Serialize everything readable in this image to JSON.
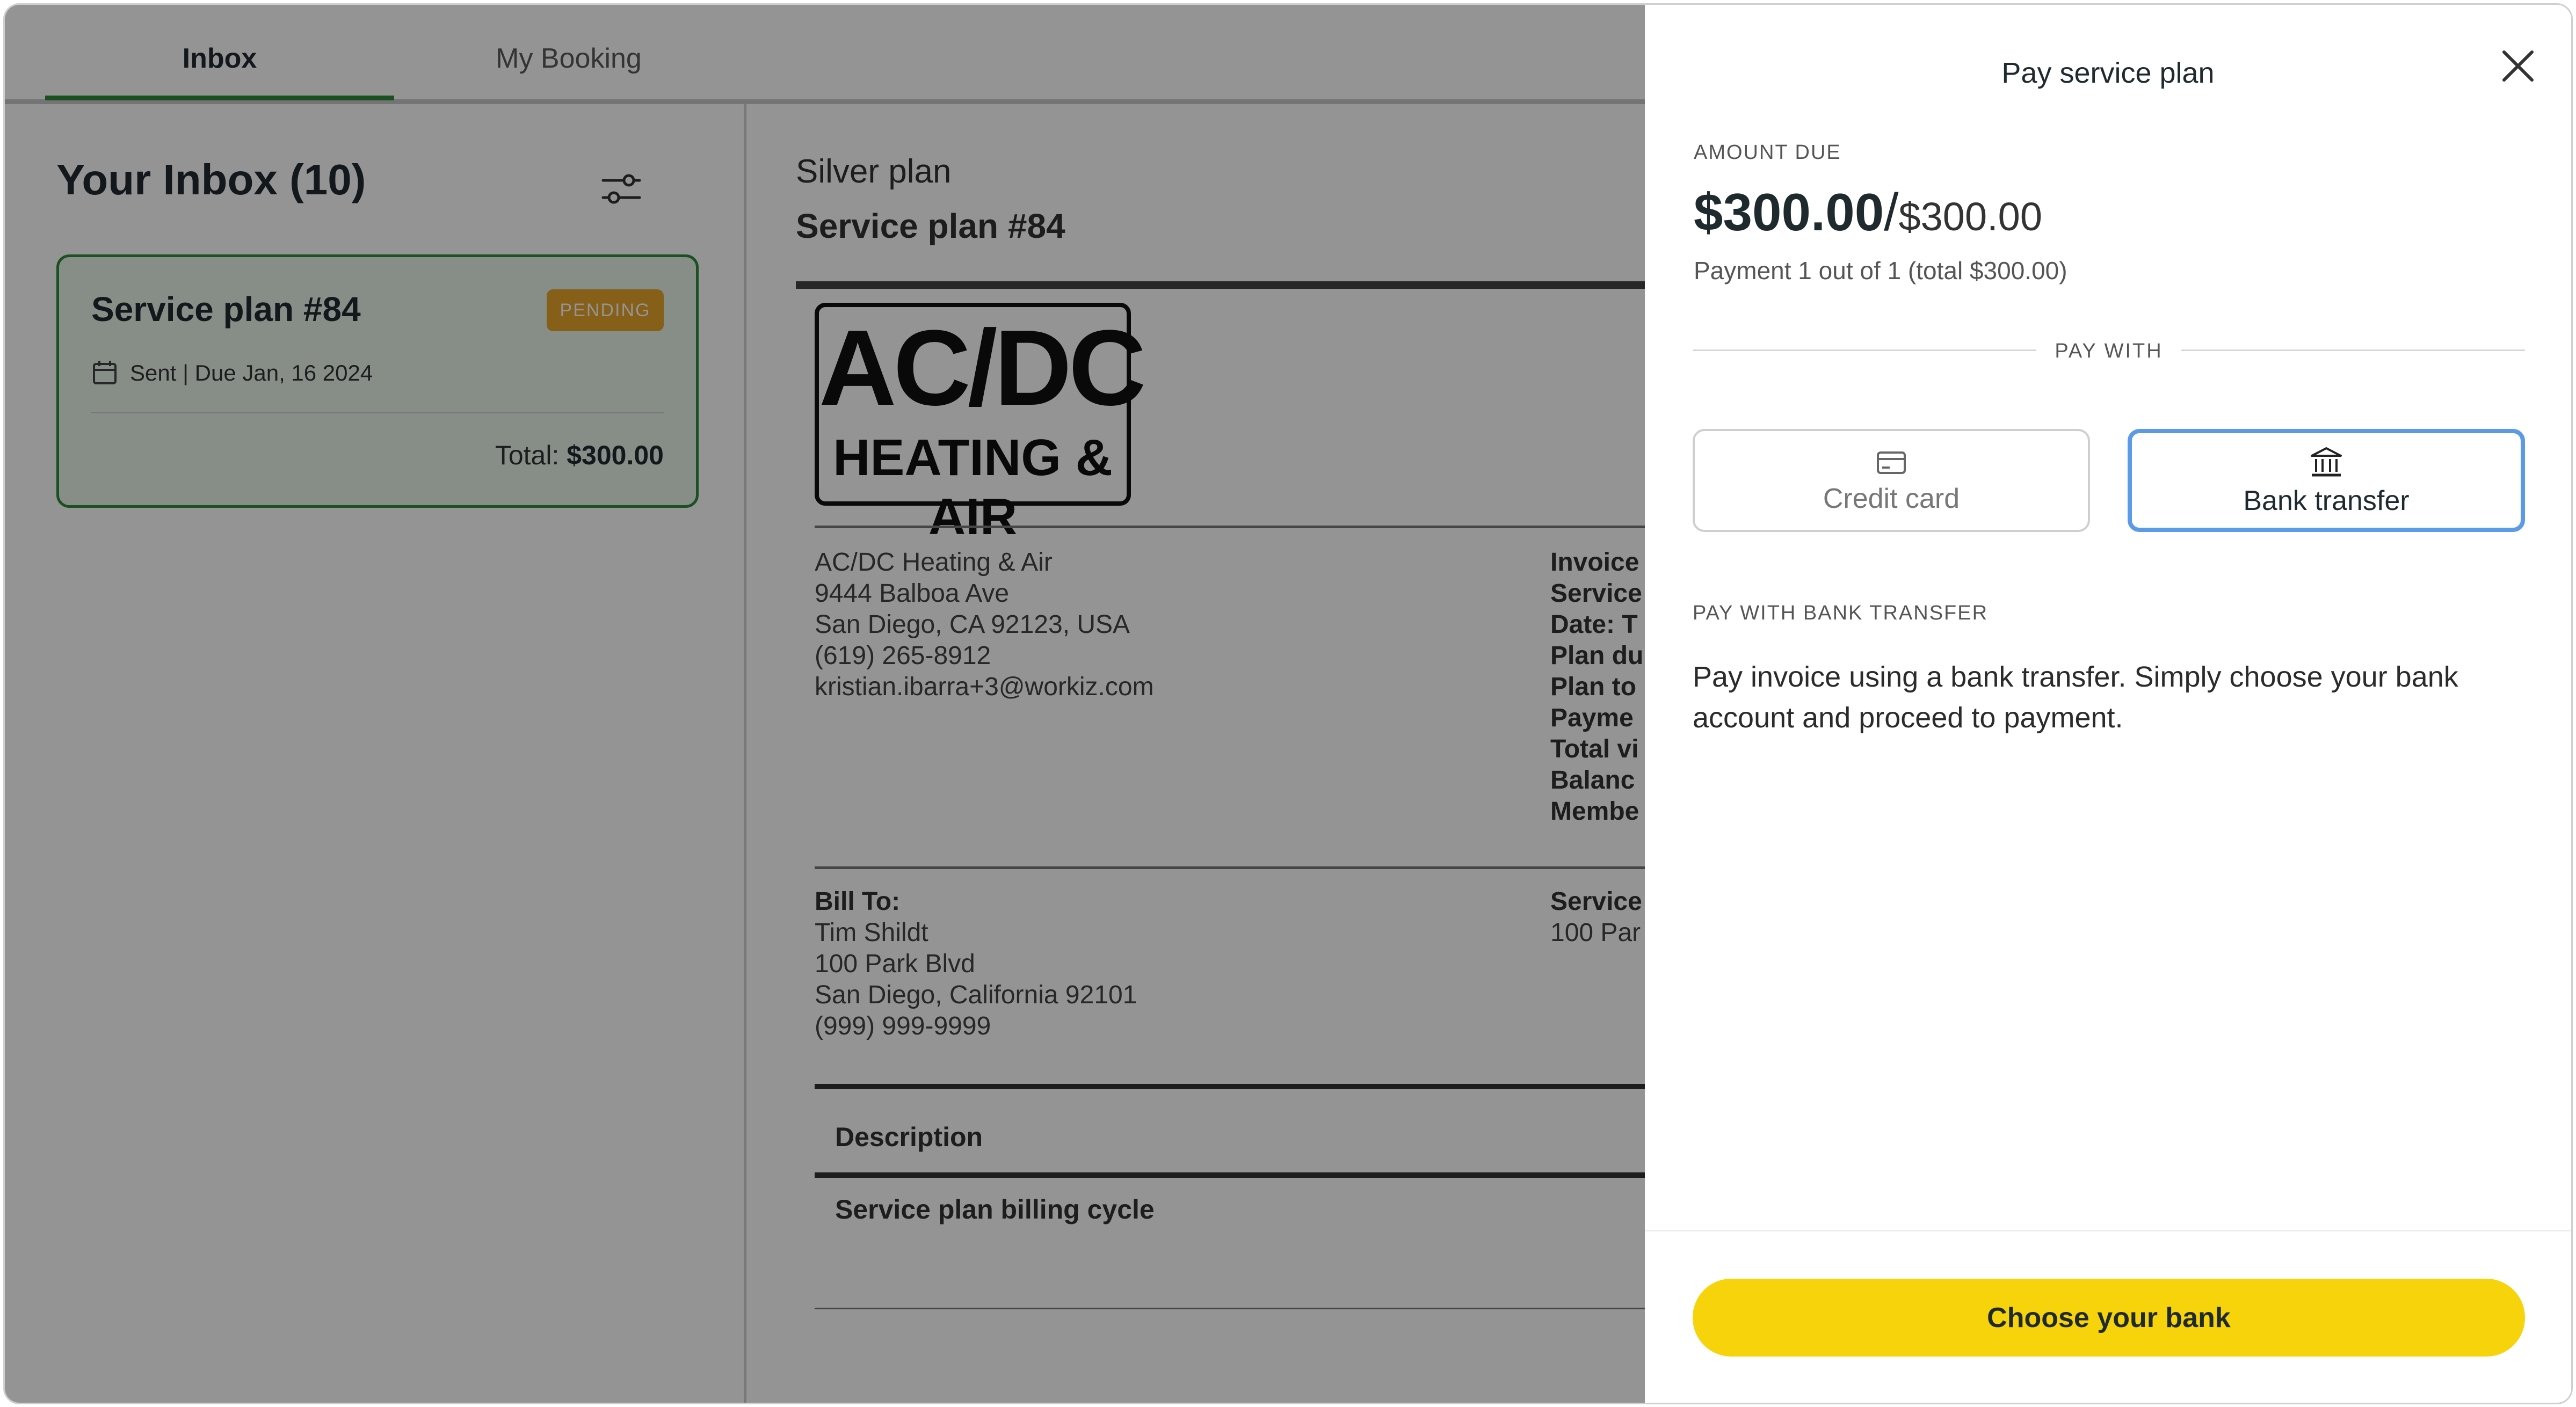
{
  "tabs": {
    "inbox": "Inbox",
    "my_booking": "My Booking"
  },
  "inbox": {
    "title": "Your Inbox (10)",
    "card": {
      "title": "Service plan #84",
      "badge": "PENDING",
      "date": "Sent | Due Jan, 16 2024",
      "total_label": "Total:",
      "total_value": "$300.00"
    }
  },
  "invoice": {
    "plan_name": "Silver plan",
    "plan_title": "Service plan #84",
    "logo_line1": "AC/DC",
    "logo_line2": "HEATING & AIR",
    "company": {
      "name": "AC/DC Heating & Air",
      "address1": "9444 Balboa Ave",
      "address2": "San Diego, CA 92123, USA",
      "phone": "(619) 265-8912",
      "email": "kristian.ibarra+3@workiz.com"
    },
    "meta": [
      "Invoice",
      "Service",
      "Date: T",
      "Plan du",
      "Plan to",
      "Payme",
      "Total vi",
      "Balanc",
      "Membe"
    ],
    "bill_to": {
      "label": "Bill To:",
      "name": "Tim Shildt",
      "address1": "100 Park Blvd",
      "address2": "San Diego, California 92101",
      "phone": "(999) 999-9999"
    },
    "service": {
      "label": "Service",
      "address": "100 Par"
    },
    "description_header": "Description",
    "description_row": "Service plan billing cycle"
  },
  "drawer": {
    "title": "Pay service plan",
    "amount_label": "AMOUNT DUE",
    "amount_due": "$300.00",
    "amount_slash": "/",
    "amount_total": "$300.00",
    "payment_info": "Payment 1 out of 1 (total $300.00)",
    "pay_with_label": "PAY WITH",
    "methods": {
      "credit_card": "Credit card",
      "bank_transfer": "Bank transfer"
    },
    "selected_method": "bank_transfer",
    "bank_section_label": "PAY WITH BANK TRANSFER",
    "bank_description": "Pay invoice using a bank transfer. Simply choose your bank account and proceed to payment.",
    "choose_bank_button": "Choose your bank"
  },
  "colors": {
    "accent_green": "#2e8b3c",
    "pending_badge": "#e7a42a",
    "selected_border": "#5b9be6",
    "primary_button": "#f6d30a"
  },
  "icons": {
    "filter": "filter-sliders-icon",
    "calendar": "calendar-icon",
    "credit_card": "credit-card-icon",
    "bank": "bank-icon",
    "close": "close-icon"
  }
}
